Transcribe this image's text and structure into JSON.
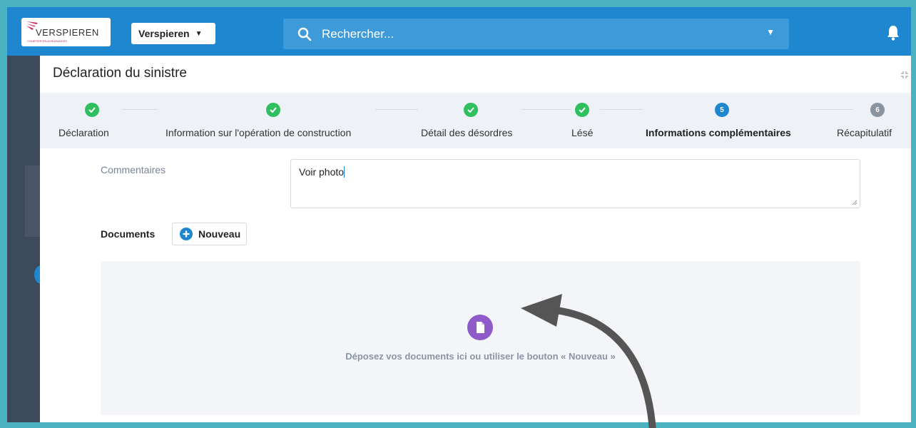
{
  "topbar": {
    "logo_text": "VERSPIEREN",
    "logo_subtext": "COURTIER EN ASSURANCES",
    "company_select": "Verspieren",
    "search_placeholder": "Rechercher..."
  },
  "modal": {
    "title": "Déclaration du sinistre",
    "steps": [
      {
        "label": "Déclaration",
        "status": "done"
      },
      {
        "label": "Information sur l'opération de construction",
        "status": "done"
      },
      {
        "label": "Détail des désordres",
        "status": "done"
      },
      {
        "label": "Lésé",
        "status": "done"
      },
      {
        "label": "Informations complémentaires",
        "number": "5",
        "status": "active"
      },
      {
        "label": "Récapitulatif",
        "number": "6",
        "status": "pending"
      }
    ],
    "comments_label": "Commentaires",
    "comments_value": "Voir photo",
    "documents_label": "Documents",
    "new_button": "Nouveau",
    "dropzone_text": "Déposez vos documents ici ou utiliser le bouton « Nouveau »"
  },
  "colors": {
    "brand_blue": "#1f87d0",
    "success_green": "#2fbf5f",
    "pending_grey": "#8a93a0",
    "file_icon_purple": "#8e5bc8",
    "frame_teal": "#4bb3c0"
  },
  "icons": [
    "search-icon",
    "bell-icon",
    "collapse-icon",
    "check-icon",
    "plus-circle-icon",
    "file-icon",
    "arrow-annotation"
  ]
}
